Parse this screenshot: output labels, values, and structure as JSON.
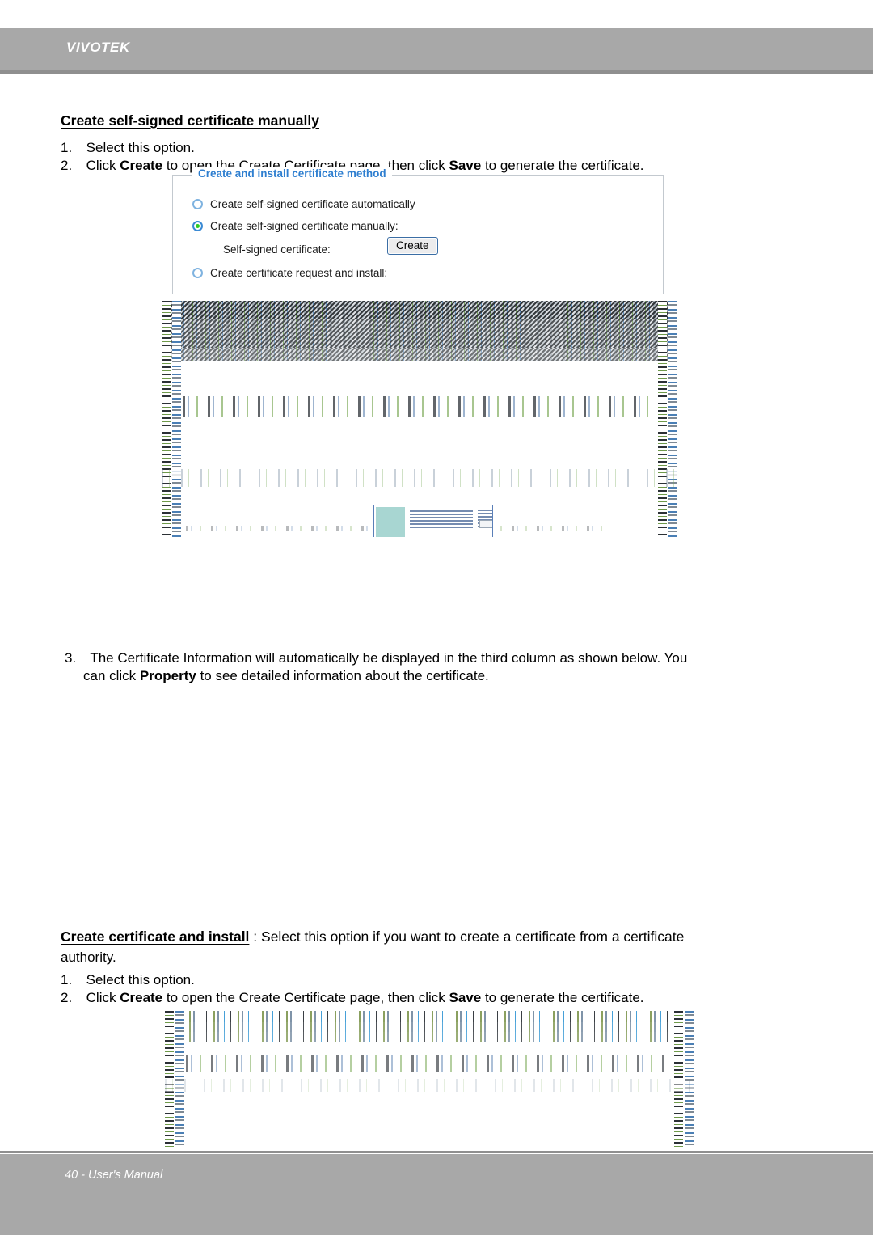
{
  "header": {
    "brand": "VIVOTEK"
  },
  "footer": {
    "page_label": "40 - User's Manual"
  },
  "sections": {
    "manual_cert": {
      "heading": "Create self-signed certificate manually",
      "steps": [
        {
          "number": "1.",
          "text": "Select this option."
        },
        {
          "number": "2.",
          "prefix": "Click ",
          "bold1": "Create",
          "middle": " to open the Create Certificate page, then click ",
          "bold2": "Save",
          "suffix": " to generate the certificate."
        }
      ]
    },
    "step3": {
      "number": "3.",
      "line1": "The Certificate Information will automatically be displayed in the third column as shown below. You",
      "line2_prefix": "can click ",
      "line2_bold": "Property",
      "line2_suffix": " to see detailed information about the certificate."
    },
    "install_cert": {
      "heading": "Create certificate and install",
      "heading_separator": " : ",
      "description_line1": "Select this option if you want to create a certificate from a certificate",
      "description_line2": "authority.",
      "steps": [
        {
          "number": "1.",
          "text": "Select this option."
        },
        {
          "number": "2.",
          "prefix": "Click ",
          "bold1": "Create",
          "middle": " to open the Create Certificate page, then click ",
          "bold2": "Save",
          "suffix": " to generate the certificate."
        }
      ]
    }
  },
  "cert_panel": {
    "legend": "Create and install certificate method",
    "options": [
      {
        "label": "Create self-signed certificate automatically",
        "selected": false
      },
      {
        "label": "Create self-signed certificate manually:",
        "selected": true
      },
      {
        "label": "Create certificate request and install:",
        "selected": false
      }
    ],
    "sub_field_label": "Self-signed certificate:",
    "create_button_label": "Create"
  },
  "colors": {
    "header_gray": "#a8a8a8",
    "rule_gray": "#8f8f8f",
    "legend_blue": "#2f7fd0",
    "radio_ring_blue": "#7fb3e0",
    "radio_dot_green": "#2ecc22",
    "button_border_blue": "#3b6ea5",
    "panel_border": "#c3c9cf"
  }
}
